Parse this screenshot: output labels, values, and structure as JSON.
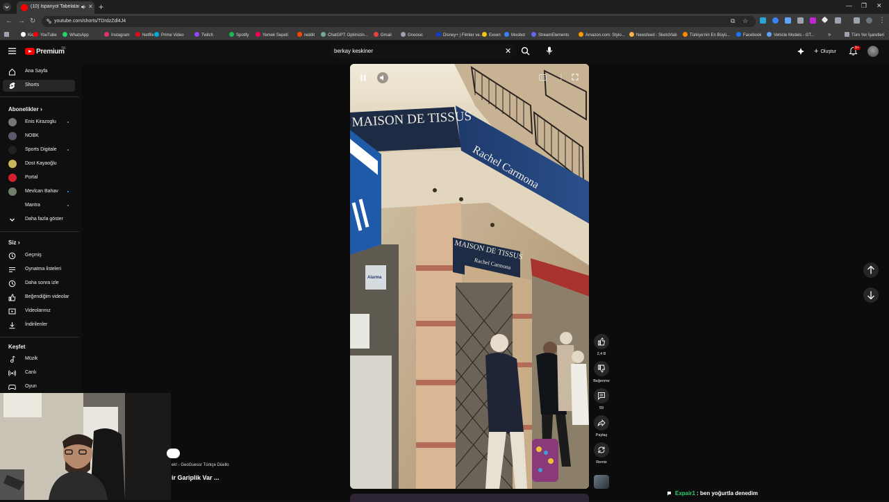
{
  "browser": {
    "tab_title": "(10) İspanyol Tabelalarında",
    "url": "youtube.com/shorts/TDrdzZdl4J4",
    "bookmarks": [
      "Kick",
      "YouTube",
      "WhatsApp",
      "Instagram",
      "Netflix",
      "Prime Video",
      "Twitch",
      "Spotify",
      "Yemek Sepeti",
      "reddit",
      "ChatGPT: Optimizin...",
      "Gmail",
      "Gnoosic",
      "Disney+ | Filmler ve...",
      "Exxen",
      "Moobot",
      "StreamElements",
      "Amazon.com: Stylo...",
      "Newsfeed - Sketchfab",
      "Türkiye'nin En Büyü...",
      "Facebook",
      "Vehicle Models - GT..."
    ],
    "all_bookmarks": "Tüm Yer İşaretleri"
  },
  "header": {
    "brand": "Premium",
    "brand_tr": "TR",
    "search_query": "berkay keskiner",
    "create_label": "Oluştur",
    "notif_count": "9+"
  },
  "sidebar": {
    "main": [
      {
        "label": "Ana Sayfa",
        "icon": "home-icon"
      },
      {
        "label": "Shorts",
        "icon": "shorts-icon",
        "active": true
      }
    ],
    "subs_title": "Abonelikler",
    "subs": [
      {
        "label": "Enis Kirazoglu",
        "dot": true,
        "color": "#777777"
      },
      {
        "label": "NOBK",
        "dot": false,
        "color": "#5a5a6a"
      },
      {
        "label": "Sports Digitale",
        "dot": true,
        "color": "#222222"
      },
      {
        "label": "Dost Kayaoğlu",
        "dot": false,
        "color": "#c9b45a"
      },
      {
        "label": "Portal",
        "dot": false,
        "color": "#d21f2b"
      },
      {
        "label": "Mevlcan Bahav",
        "dot": true,
        "color": "#6f7f6a"
      },
      {
        "label": "Mantra",
        "dot": true,
        "color": "#111111"
      }
    ],
    "show_more": "Daha fazla göster",
    "you_title": "Siz",
    "you": [
      {
        "label": "Geçmiş",
        "icon": "history-icon"
      },
      {
        "label": "Oynatma listeleri",
        "icon": "playlists-icon"
      },
      {
        "label": "Daha sonra izle",
        "icon": "watch-later-icon"
      },
      {
        "label": "Beğendiğim videolar",
        "icon": "liked-videos-icon"
      },
      {
        "label": "Videolarınız",
        "icon": "your-videos-icon"
      },
      {
        "label": "İndirilenler",
        "icon": "downloads-icon"
      }
    ],
    "explore_title": "Keşfet",
    "explore": [
      {
        "label": "Müzik",
        "icon": "music-icon"
      },
      {
        "label": "Canlı",
        "icon": "live-icon"
      },
      {
        "label": "Oyun",
        "icon": "gaming-icon"
      }
    ]
  },
  "video": {
    "sign_top": "MAISON DE TISSUS",
    "sign_side": "Rachel Carmona",
    "sign_lower_1": "MAISON DE TISSUS",
    "sign_lower_2": "Rachel Carmona",
    "poster": "Alarma"
  },
  "actions": {
    "like_count": "2,4 B",
    "dislike_label": "Beğenme",
    "comment_count": "59",
    "share_label": "Paylaş",
    "remix_label": "Remix"
  },
  "overlay": {
    "peek_line_1": "ek! - GeoGuessr Türkçe Düello",
    "peek_line_2": "ir Gariplik Var ...",
    "chat_user": "Expair1",
    "chat_msg": ": ben yoğurtla denedim"
  }
}
